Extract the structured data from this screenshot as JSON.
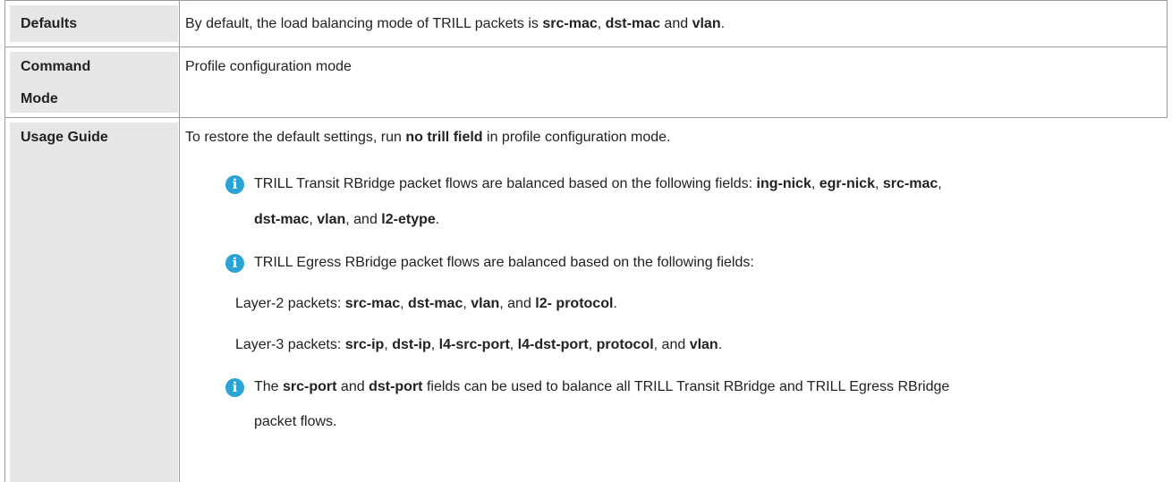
{
  "rows": {
    "defaults": {
      "label": "Defaults",
      "text_pre": "By default, the load balancing mode of TRILL packets is ",
      "k1": "src-mac",
      "sep1": ", ",
      "k2": "dst-mac",
      "sep2": " and ",
      "k3": "vlan",
      "end": "."
    },
    "command_mode": {
      "label_line1": "Command",
      "label_line2": "Mode",
      "text": "Profile configuration mode"
    },
    "usage_guide": {
      "label": "Usage Guide",
      "intro_pre": "To restore the default settings, run ",
      "intro_cmd": "no trill field",
      "intro_post": " in profile configuration mode.",
      "note1": {
        "icon": "info-icon",
        "pre": "TRILL Transit RBridge packet flows are balanced based on the following fields: ",
        "f1": "ing-nick",
        "s1": ", ",
        "f2": "egr-nick",
        "s2": ", ",
        "f3": "src-mac",
        "s3": ",",
        "f4": "dst-mac",
        "s4": ", ",
        "f5": "vlan",
        "s5": ", and ",
        "f6": "l2-etype",
        "end": "."
      },
      "note2": {
        "icon": "info-icon",
        "text": "TRILL Egress RBridge packet flows are balanced based on the following fields:",
        "l2": {
          "pre": "Layer-2 packets: ",
          "f1": "src-mac",
          "s1": ", ",
          "f2": "dst-mac",
          "s2": ", ",
          "f3": "vlan",
          "s3": ", and ",
          "f4": "l2- protocol",
          "end": "."
        },
        "l3": {
          "pre": "Layer-3 packets: ",
          "f1": "src-ip",
          "s1": ", ",
          "f2": "dst-ip",
          "s2": ", ",
          "f3": "l4-src-port",
          "s3": ", ",
          "f4": "l4-dst-port",
          "s4": ", ",
          "f5": "protocol",
          "s5": ", and ",
          "f6": "vlan",
          "end": "."
        }
      },
      "note3": {
        "icon": "info-icon",
        "pre": "The ",
        "f1": "src-port",
        "s1": " and ",
        "f2": "dst-port",
        "post1": " fields can be used to balance all TRILL Transit RBridge and TRILL Egress RBridge",
        "post2": "packet flows."
      }
    }
  },
  "colors": {
    "label_bg": "#e6e6e6",
    "border": "#9a9a9a",
    "info_icon": "#2aa3d6"
  }
}
